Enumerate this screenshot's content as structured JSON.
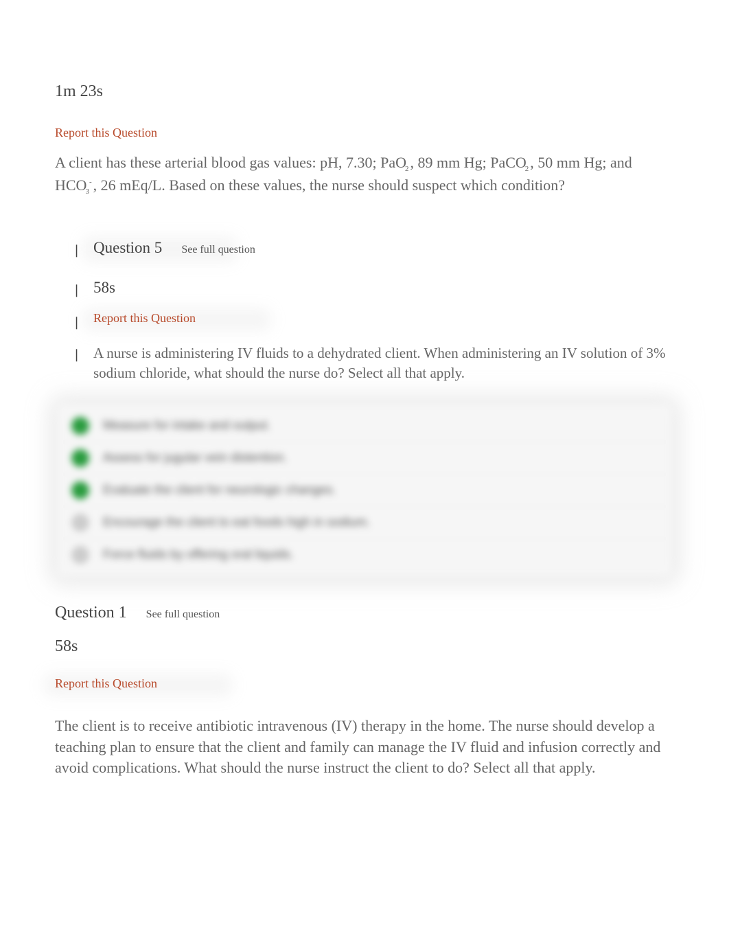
{
  "q4": {
    "timer": "1m 23s",
    "report_label": "Report this Question",
    "text_pre": "A client has these arterial blood gas values: pH, 7.30; PaO",
    "sub1": "2",
    "text_mid1": ", 89 mm Hg; PaCO",
    "sub2": "2",
    "text_mid2": ", 50 mm Hg; and HCO",
    "sub3": "3",
    "sup3": "-",
    "text_post": ", 26 mEq/L. Based on these values, the nurse should suspect which condition?"
  },
  "q5": {
    "title": "Question 5",
    "see_full": "See full question",
    "timer": "58s",
    "report_label": "Report this Question",
    "text": "A nurse is administering IV fluids to a dehydrated client. When administering an IV solution of 3% sodium chloride, what should the nurse do? Select all that apply.",
    "answers": [
      {
        "correct": true,
        "text": "Measure for intake and output."
      },
      {
        "correct": true,
        "text": "Assess for jugular vein distention."
      },
      {
        "correct": true,
        "text": "Evaluate the client for neurologic changes."
      },
      {
        "correct": false,
        "text": "Encourage the client to eat foods high in sodium."
      },
      {
        "correct": false,
        "text": "Force fluids by offering oral liquids."
      }
    ]
  },
  "q1": {
    "title": "Question 1",
    "see_full": "See full question",
    "timer": "58s",
    "report_label": "Report this Question",
    "text": "The client is to receive antibiotic intravenous (IV) therapy in the home. The nurse should develop a teaching plan to ensure that the client and family can manage the IV fluid and infusion correctly and avoid complications. What should the nurse instruct the client to do? Select all that apply."
  }
}
